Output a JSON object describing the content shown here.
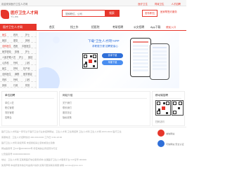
{
  "topbar": {
    "welcome": "欢迎来到医疗卫生人才网",
    "accent_prefix": "卫生人",
    "link1": "医疗卫生",
    "link2": "同城卫生",
    "link3": "人才招聘"
  },
  "header": {
    "logo_name": "医疗卫生人才网",
    "logo_url": "YL.ws",
    "search_placeholder": "搜索职位、公司",
    "search_button": "搜索",
    "post_button": "发布职位",
    "link_text": "医家帮签约服务"
  },
  "nav": {
    "category_label": "医疗卫生人才网",
    "items": [
      "首页",
      "找工作",
      "招医院",
      "考研招聘",
      "公文招聘",
      "App下载"
    ],
    "region": "便民入口"
  },
  "sidebar": {
    "rows": [
      [
        "医生",
        "药剂",
        "护士"
      ],
      [
        "医技",
        "康复",
        "其他"
      ],
      [
        "全科医生",
        "西医",
        "中医医生"
      ],
      [
        "医学检验",
        "影像",
        "护士"
      ],
      [
        "人医护理人员",
        "护士",
        "医技"
      ],
      [
        "心内科",
        "外科",
        "儿科"
      ],
      [
        "医生",
        "护科",
        "妇产科"
      ],
      [
        "全科医生",
        "麻醉",
        "医学美容"
      ],
      [
        "内科",
        "外科",
        "儿科"
      ],
      [
        "其他",
        "行政",
        "财务"
      ]
    ]
  },
  "banner": {
    "title": "下载\"卫生人才网\"APP",
    "subtitle": "求职更方便 招聘更省心",
    "android": "安卓下载",
    "ios": "苹果下载"
  },
  "sections": [
    {
      "title": "单位招聘",
      "items": [
        "单位入驻",
        "职位管理",
        "简历管理",
        "招聘会"
      ]
    },
    {
      "title": "网站介绍",
      "items": [
        "关于我们",
        "联系我们",
        "服务协议",
        "隐私政策"
      ]
    },
    {
      "title": "移动端招聘",
      "items": [
        "扫码访问"
      ]
    }
  ],
  "footer": {
    "lines": [
      "医疗卫生人才网是一家专注于医疗卫生行业的招聘网站，卫生人才网 卫生网招聘 卫生人才网 卫生人才网 2003-2022 医疗卫生",
      "客服电话：卫生人才招聘热线 400-000-0000 工作日 9:00-18:00",
      "医疗卫生人才网 版权所有 未经授权禁止复制或建立镜像",
      "网站备案号 卫ICP备00000000号 增值电信业务经营许可证",
      "公安备案号 00000000000000",
      "地址：卫生人才网 互联网医疗信息服务机构 全国医疗卫生人才服务平台 ICP证号 000000",
      "免责声明 本站所发布信息均由用户提供 如有问题请联系客服 邮箱 service@ylws.com"
    ],
    "badge1": "诚信网站",
    "badge2": "可信网站 安全认证"
  },
  "colors": {
    "accent": "#e6362b",
    "banner_blue": "#2f6fd8"
  }
}
